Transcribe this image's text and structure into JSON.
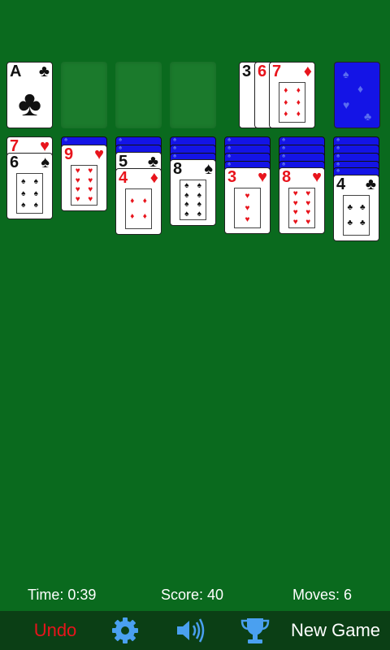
{
  "foundations": [
    {
      "rank": "A",
      "suit": "♣",
      "color": "black"
    }
  ],
  "waste": [
    {
      "rank": "3",
      "suit": "♠",
      "color": "black"
    },
    {
      "rank": "6",
      "suit": "♥",
      "color": "red"
    },
    {
      "rank": "7",
      "suit": "♦",
      "color": "red"
    }
  ],
  "tableau": [
    {
      "cards": [
        {
          "rank": "7",
          "suit": "♥",
          "color": "red"
        },
        {
          "rank": "6",
          "suit": "♠",
          "color": "black"
        }
      ]
    },
    {
      "cards": [
        {
          "rank": "9",
          "suit": "♥",
          "color": "red"
        }
      ]
    },
    {
      "cards": [
        {
          "rank": "5",
          "suit": "♣",
          "color": "black"
        },
        {
          "rank": "4",
          "suit": "♦",
          "color": "red"
        }
      ]
    },
    {
      "cards": [
        {
          "rank": "8",
          "suit": "♠",
          "color": "black"
        }
      ]
    },
    {
      "cards": [
        {
          "rank": "3",
          "suit": "♥",
          "color": "red"
        }
      ]
    },
    {
      "cards": [
        {
          "rank": "8",
          "suit": "♥",
          "color": "red"
        }
      ]
    },
    {
      "cards": [
        {
          "rank": "4",
          "suit": "♣",
          "color": "black"
        }
      ]
    }
  ],
  "status": {
    "time_label": "Time: 0:39",
    "score_label": "Score: 40",
    "moves_label": "Moves: 6"
  },
  "toolbar": {
    "undo_label": "Undo",
    "new_game_label": "New Game",
    "settings_icon": "gear-icon",
    "sound_icon": "speaker-icon",
    "trophy_icon": "trophy-icon"
  },
  "colors": {
    "felt": "#0a6a1e",
    "card_back": "#1414e6",
    "red_suit": "#e8141c",
    "toolbar": "#0b3f15",
    "icon_blue": "#4aa0f0"
  }
}
